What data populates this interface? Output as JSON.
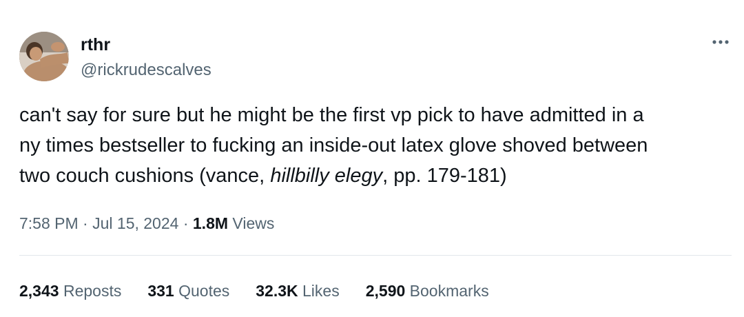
{
  "author": {
    "display_name": "rthr",
    "handle": "@rickrudescalves"
  },
  "icons": {
    "more": "more-horizontal-icon"
  },
  "tweet": {
    "lines": [
      "can't say for sure but he might be the first vp pick to have admitted in a",
      "ny times bestseller to fucking an inside-out latex glove shoved between"
    ],
    "line3_before": "two couch cushions (vance, ",
    "line3_italic": "hillbilly elegy",
    "line3_after": ", pp. 179-181)"
  },
  "meta": {
    "time": "7:58 PM",
    "separator": "·",
    "date": "Jul 15, 2024",
    "views_count": "1.8M",
    "views_label": "Views"
  },
  "stats": {
    "reposts": {
      "count": "2,343",
      "label": "Reposts"
    },
    "quotes": {
      "count": "331",
      "label": "Quotes"
    },
    "likes": {
      "count": "32.3K",
      "label": "Likes"
    },
    "bookmarks": {
      "count": "2,590",
      "label": "Bookmarks"
    }
  },
  "colors": {
    "text": "#0f1419",
    "secondary": "#536471",
    "divider": "#e1e6ea"
  }
}
